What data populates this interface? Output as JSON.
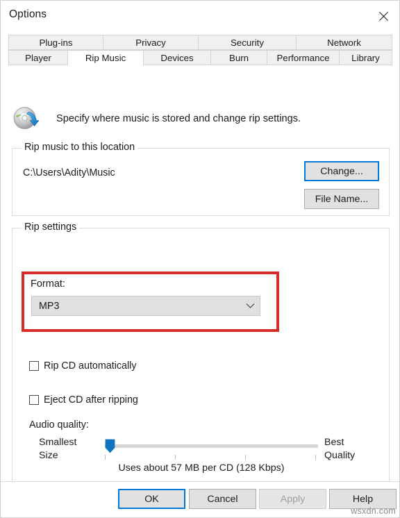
{
  "window": {
    "title": "Options",
    "close_icon": "close-icon"
  },
  "tabs": {
    "top_row": [
      {
        "label": "Plug-ins",
        "active": false,
        "width": 136
      },
      {
        "label": "Privacy",
        "active": false,
        "width": 137
      },
      {
        "label": "Security",
        "active": false,
        "width": 141
      },
      {
        "label": "Network",
        "active": false,
        "width": 139
      }
    ],
    "bottom_row": [
      {
        "label": "Player",
        "active": false,
        "width": 85
      },
      {
        "label": "Rip Music",
        "active": true,
        "width": 109
      },
      {
        "label": "Devices",
        "active": false,
        "width": 97
      },
      {
        "label": "Burn",
        "active": false,
        "width": 81
      },
      {
        "label": "Performance",
        "active": false,
        "width": 104
      },
      {
        "label": "Library",
        "active": false,
        "width": 77
      }
    ]
  },
  "header": {
    "icon": "cd-rip-icon",
    "description": "Specify where music is stored and change rip settings."
  },
  "rip_location": {
    "legend": "Rip music to this location",
    "path": "C:\\Users\\Adity\\Music",
    "change_button": "Change...",
    "filename_button": "File Name..."
  },
  "rip_settings": {
    "legend": "Rip settings",
    "format_label": "Format:",
    "format_value": "MP3",
    "format_dropdown_icon": "chevron-down-icon",
    "highlight_color": "#d52b2b",
    "checkboxes": [
      {
        "label": "Rip CD automatically",
        "checked": false
      },
      {
        "label": "Eject CD after ripping",
        "checked": false
      }
    ],
    "audio_quality": {
      "label": "Audio quality:",
      "left_label_line1": "Smallest",
      "left_label_line2": "Size",
      "right_label_line1": "Best",
      "right_label_line2": "Quality",
      "slider_value_percent": 0,
      "tick_positions_percent": [
        0,
        33,
        66,
        99
      ],
      "note": "Uses about 57 MB per CD (128 Kbps)"
    }
  },
  "footer": {
    "ok": "OK",
    "cancel": "Cancel",
    "apply": "Apply",
    "apply_disabled": true,
    "help": "Help"
  },
  "watermark": "wsxdn.com",
  "colors": {
    "accent": "#0078d7",
    "annotation": "#d52b2b",
    "button_face": "#e1e1e1",
    "window_bg": "#ffffff"
  }
}
